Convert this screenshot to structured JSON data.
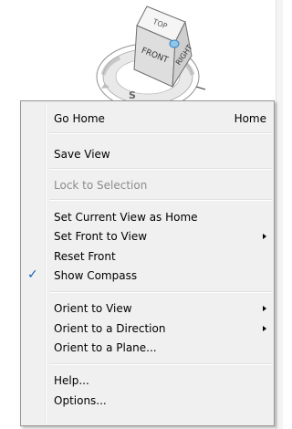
{
  "viewcube": {
    "faces": {
      "top": "TOP",
      "front": "FRONT",
      "right": "RIGHT"
    },
    "compass": {
      "south_letter": "S"
    }
  },
  "menu": {
    "items": [
      {
        "label": "Go Home",
        "shortcut": "Home"
      },
      {
        "label": "Save View"
      },
      {
        "label": "Lock to Selection",
        "disabled": true
      },
      {
        "label": "Set Current View as Home"
      },
      {
        "label": "Set Front to View",
        "submenu": true
      },
      {
        "label": "Reset Front"
      },
      {
        "label": "Show Compass",
        "checked": true,
        "check_glyph": "✓"
      },
      {
        "label": "Orient to View",
        "submenu": true
      },
      {
        "label": "Orient to a Direction",
        "submenu": true
      },
      {
        "label": "Orient to a Plane..."
      },
      {
        "label": "Help..."
      },
      {
        "label": "Options..."
      }
    ]
  },
  "colors": {
    "check": "#1a5db3",
    "disabled_text": "#8c8c8c",
    "menu_bg": "#f0f0f0"
  }
}
